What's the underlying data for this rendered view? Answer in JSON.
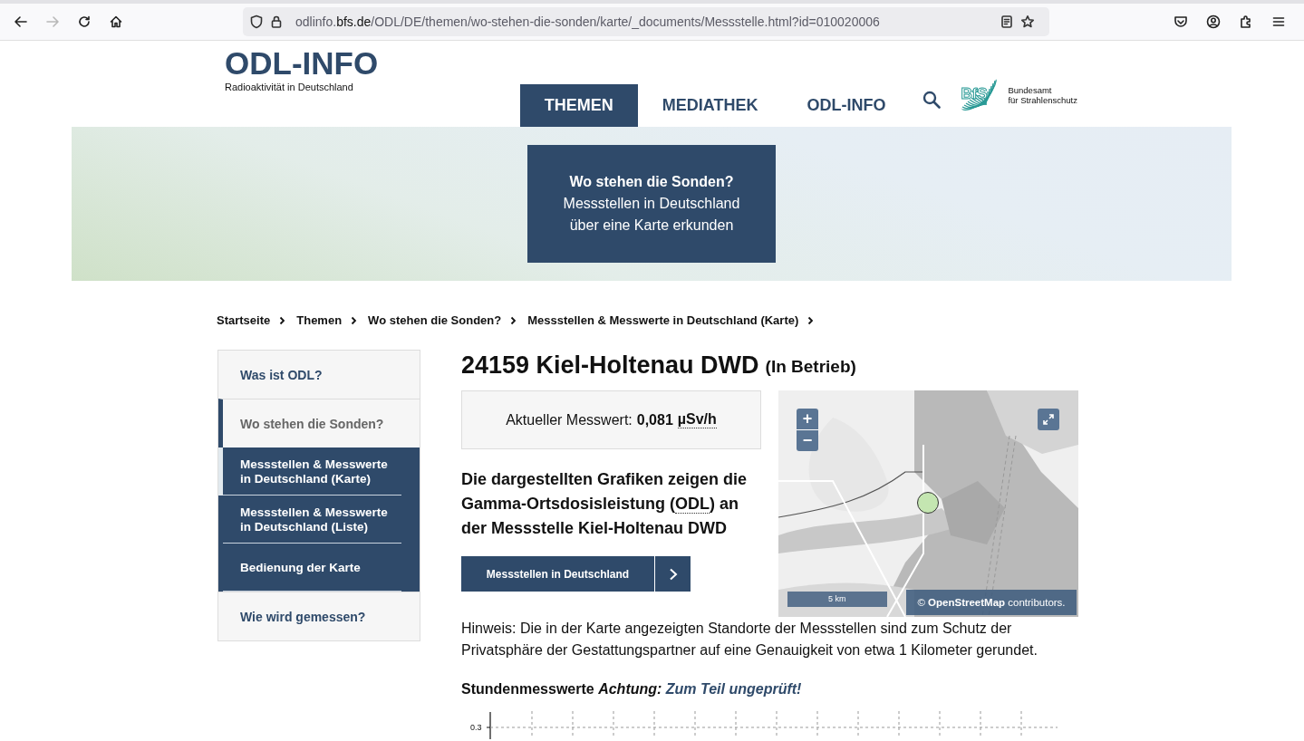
{
  "browser": {
    "back_disabled": false,
    "forward_disabled": true,
    "url": {
      "prefix": "odlinfo.",
      "domain": "bfs.de",
      "path": "/ODL/DE/themen/wo-stehen-die-sonden/karte/_documents/Messstelle.html?id=010020006"
    }
  },
  "header": {
    "logo_title": "ODL-INFO",
    "logo_subtitle": "Radioaktivität in Deutschland",
    "nav": [
      {
        "label": "THEMEN",
        "selected": true
      },
      {
        "label": "MEDIATHEK",
        "selected": false
      },
      {
        "label": "ODL-INFO",
        "selected": false
      }
    ],
    "partner_logo": {
      "mark": "BfS",
      "lines": [
        "Bundesamt",
        "für Strahlenschutz"
      ]
    }
  },
  "banner": {
    "title": "Wo stehen die Sonden?",
    "lines": [
      "Messstellen in Deutschland",
      "über eine Karte erkunden"
    ]
  },
  "breadcrumb": [
    "Startseite",
    "Themen",
    "Wo stehen die Sonden?",
    "Messstellen & Messwerte in Deutschland (Karte)"
  ],
  "sidebar": {
    "items": [
      {
        "label": "Was ist ODL?",
        "expanded": false
      },
      {
        "label": "Wo stehen die Sonden?",
        "expanded": true,
        "children": [
          {
            "label": "Messstellen & Messwerte in Deutschland (Karte)",
            "selected": true
          },
          {
            "label": "Messstellen & Messwerte in Deutschland (Liste)",
            "selected": false
          },
          {
            "label": "Bedienung der Karte",
            "selected": false
          }
        ]
      },
      {
        "label": "Wie wird gemessen?",
        "expanded": false
      }
    ]
  },
  "station": {
    "title": "24159 Kiel-Holtenau DWD",
    "status": "(In Betrieb)",
    "measurement_label": "Aktueller Messwert:",
    "measurement_value": "0,081",
    "measurement_unit": "µSv/h"
  },
  "intro": {
    "before": "Die dargestellten Grafiken zeigen die Gamma-Ortsdosisleistung (",
    "abbr": "ODL",
    "after": ") an der Messstelle Kiel-Holtenau DWD"
  },
  "overview_button": {
    "label": "Messstellen in Deutschland"
  },
  "map": {
    "kind": "picture",
    "zoom_in": "+",
    "zoom_out": "−",
    "scale": "5 km",
    "attribution_link": "OpenStreetMap",
    "attribution_prefix": "©",
    "attribution_suffix": "contributors."
  },
  "hint": "Hinweis: Die in der Karte angezeigten Standorte der Messstellen sind zum Schutz der Privatsphäre der Gestattungspartner auf eine Genauigkeit von etwa 1 Kilometer gerundet.",
  "chart_section": {
    "heading": "Stundenmesswerte *Achtung:*",
    "link": "Zum Teil ungeprüft!",
    "y_tick": "0.3"
  }
}
